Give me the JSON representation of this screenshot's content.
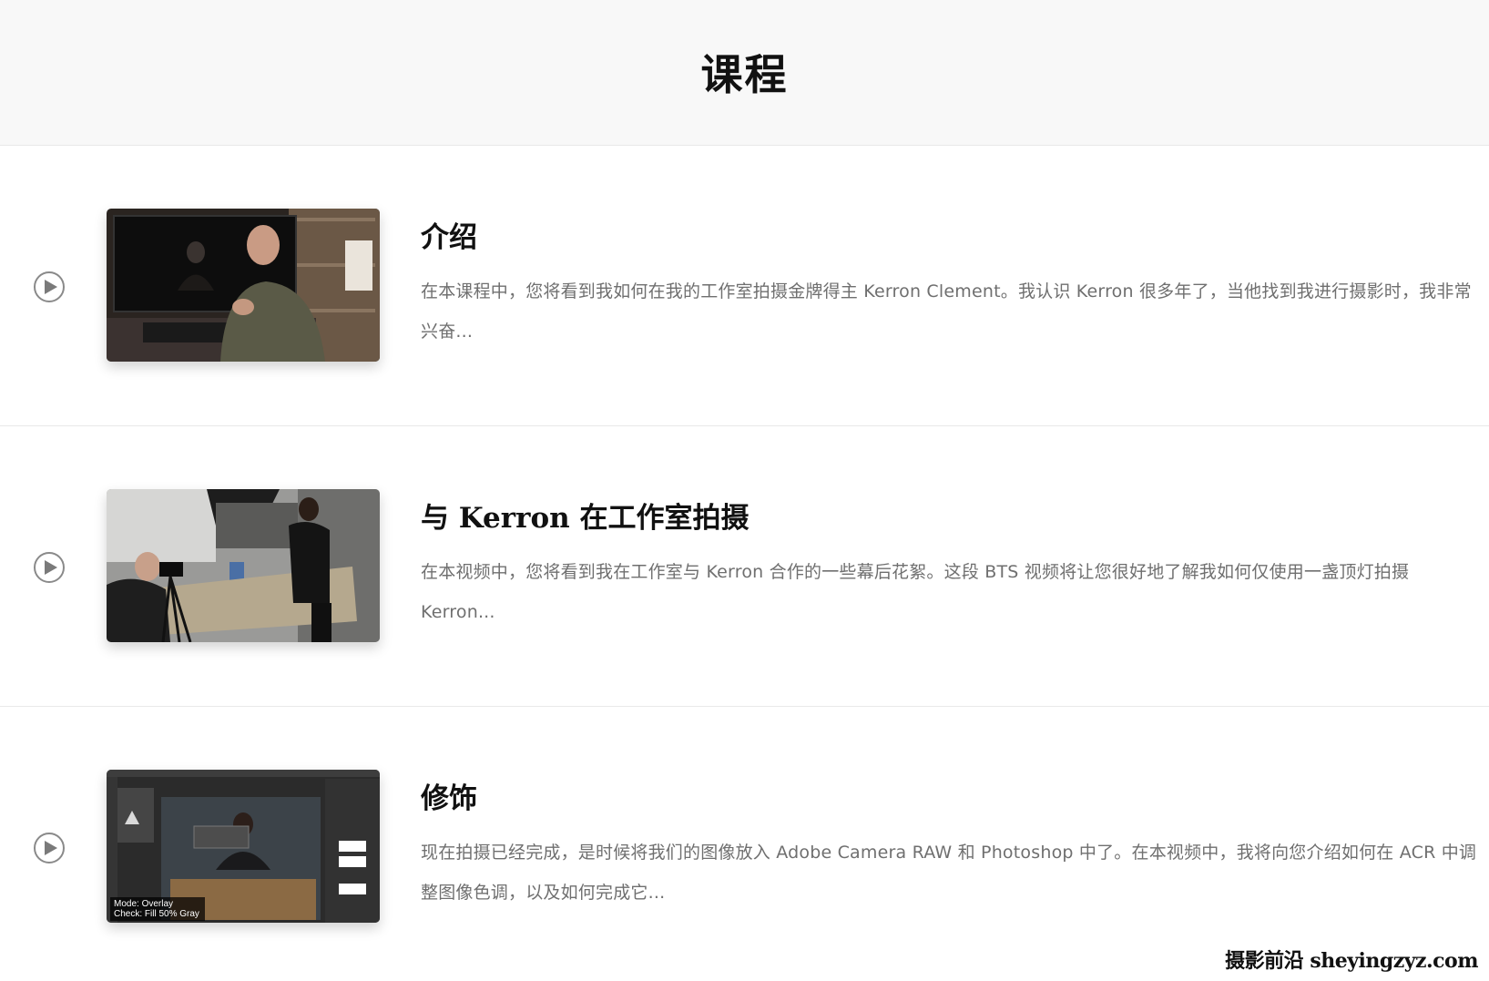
{
  "header": {
    "title": "课程"
  },
  "lessons": [
    {
      "title": "介绍",
      "description": "在本课程中，您将看到我如何在我的工作室拍摄金牌得主 Kerron Clement。我认识 Kerron 很多年了，当他找到我进行摄影时，我非常兴奋...",
      "thumbnail_icon": "video-thumbnail-man-at-desk"
    },
    {
      "title": "与 Kerron 在工作室拍摄",
      "description": "在本视频中，您将看到我在工作室与 Kerron 合作的一些幕后花絮。这段 BTS 视频将让您很好地了解我如何仅使用一盏顶灯拍摄 Kerron...",
      "thumbnail_icon": "video-thumbnail-studio-shoot"
    },
    {
      "title": "修饰",
      "description": "现在拍摄已经完成，是时候将我们的图像放入 Adobe Camera RAW 和 Photoshop 中了。在本视频中，我将向您介绍如何在 ACR 中调整图像色调，以及如何完成它...",
      "thumbnail_icon": "video-thumbnail-photoshop",
      "thumbnail_caption_line1": "Mode: Overlay",
      "thumbnail_caption_line2": "Check: Fill 50% Gray"
    }
  ],
  "watermark": "摄影前沿 sheyingzyz.com",
  "colors": {
    "header_bg": "#f8f8f8",
    "divider": "#e9e9e9",
    "desc_text": "#6f6f6f",
    "play_icon": "#8a8a8a"
  }
}
